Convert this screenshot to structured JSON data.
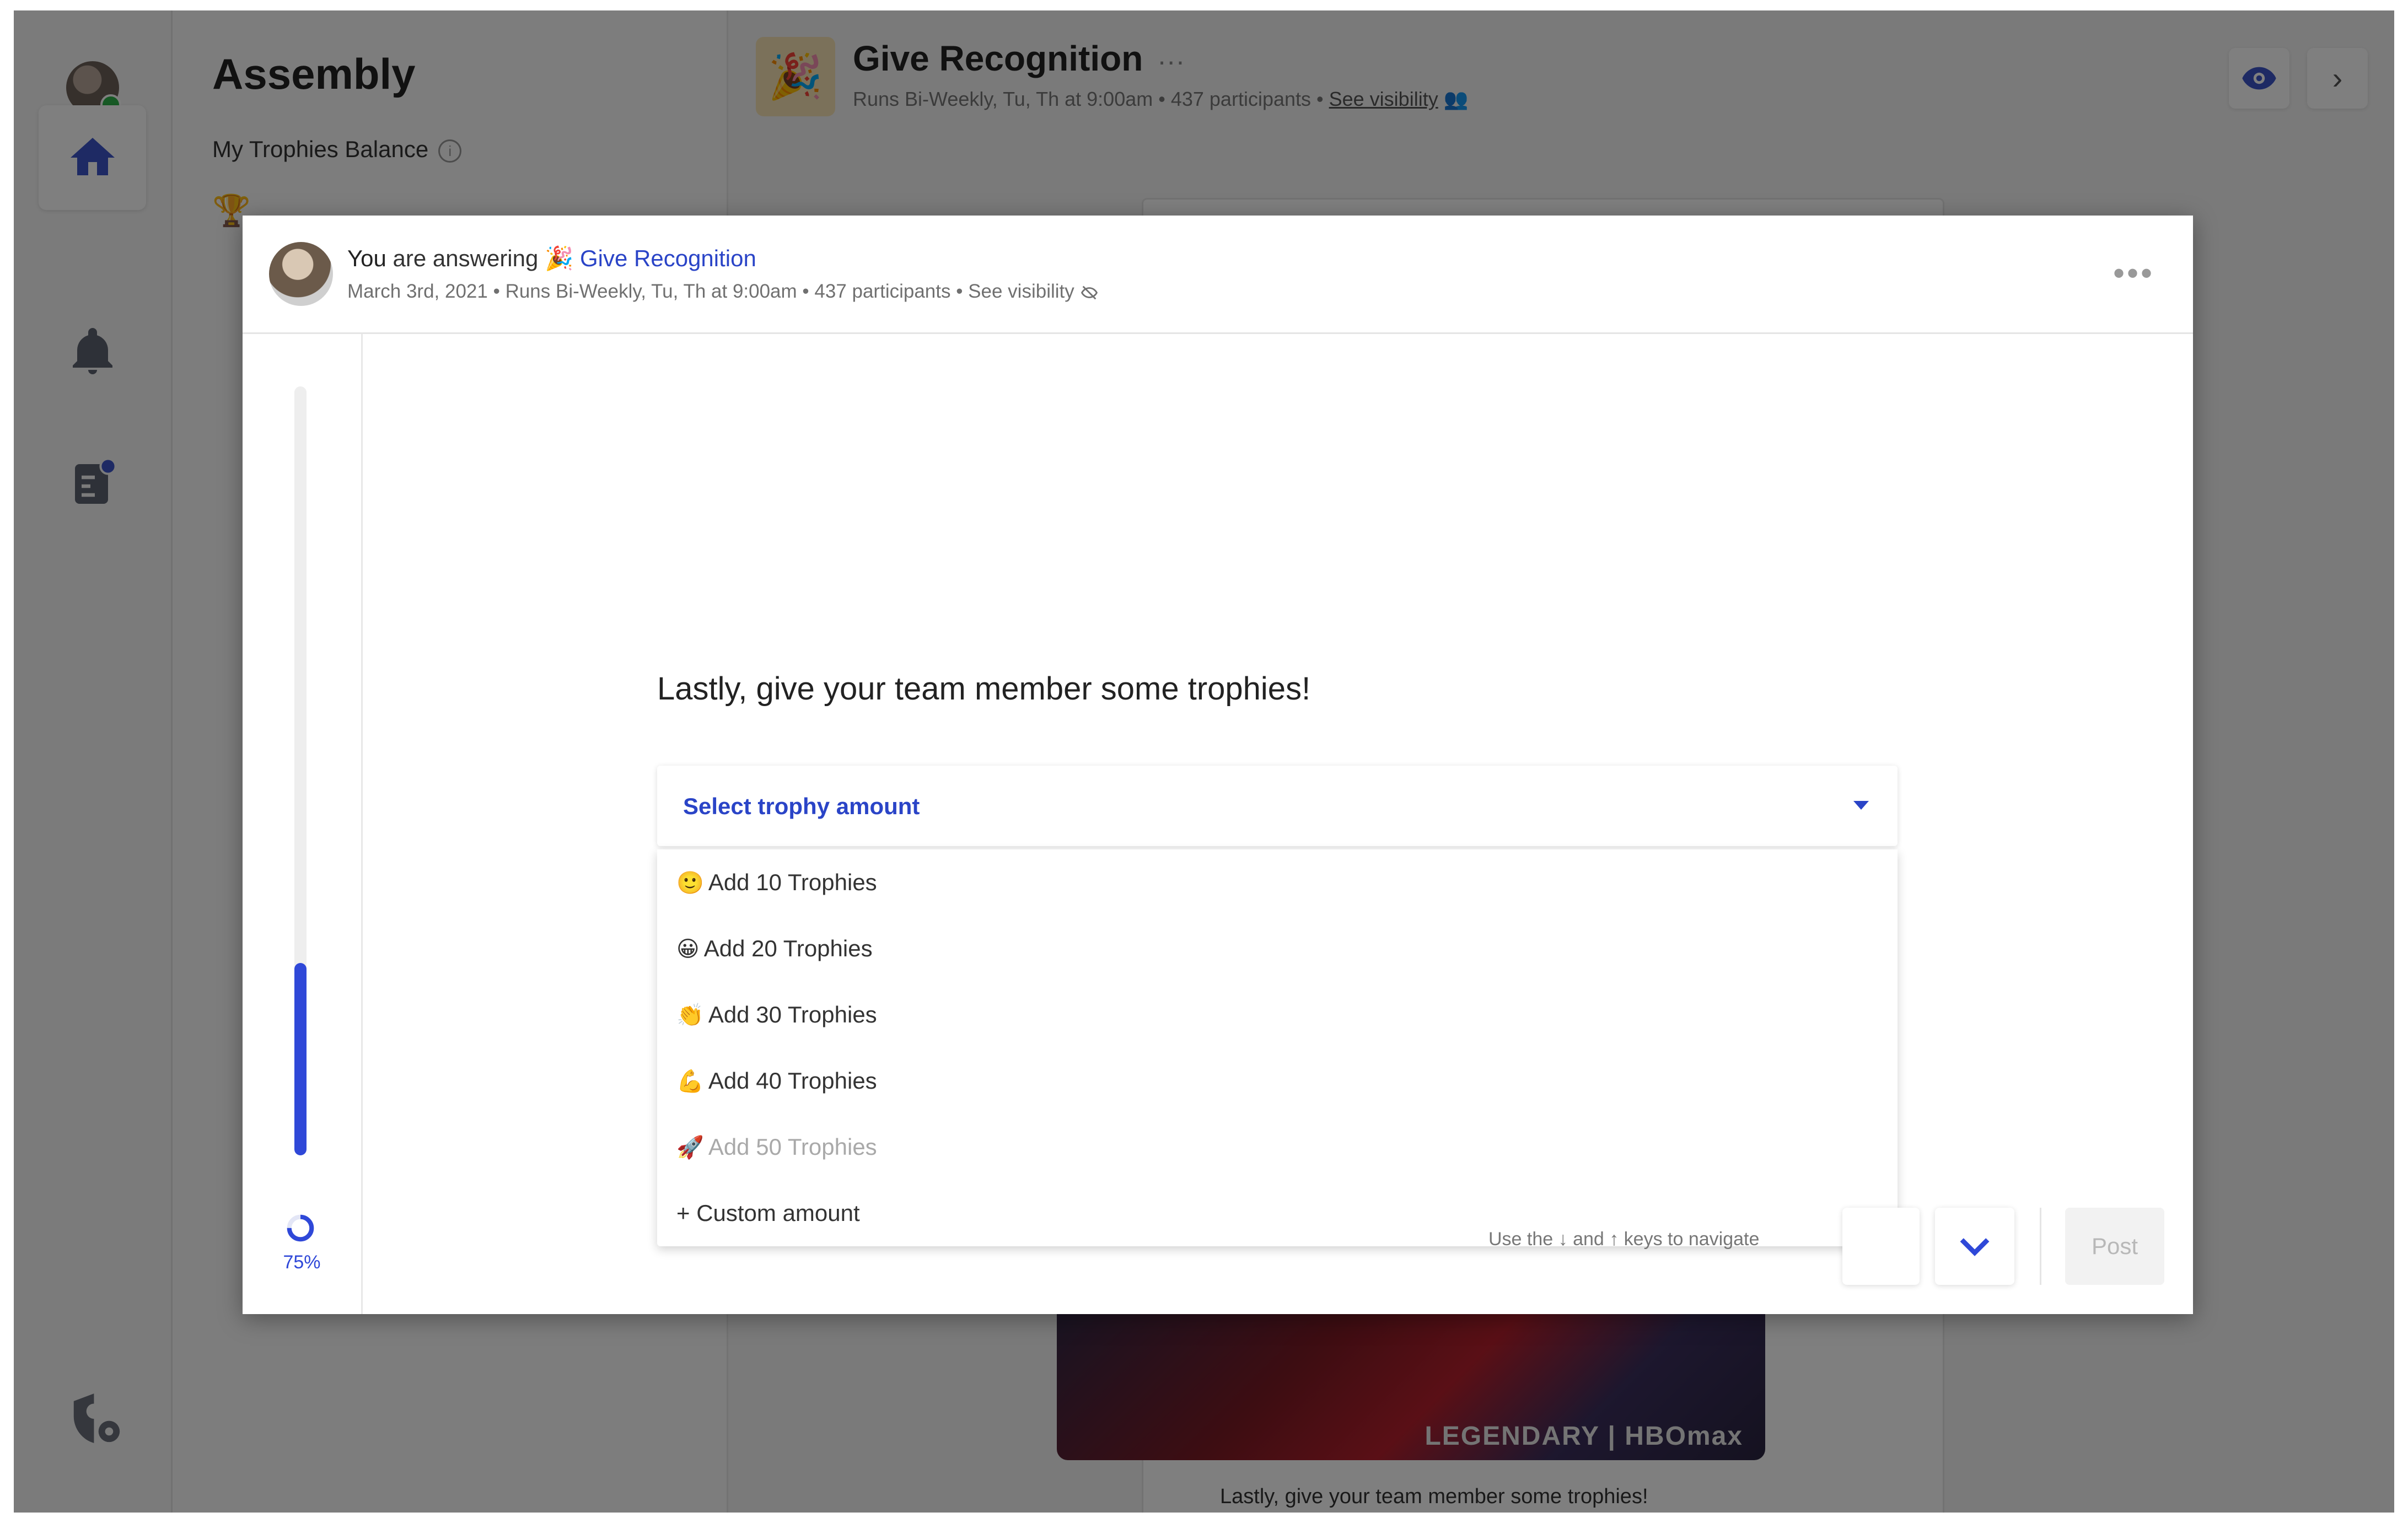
{
  "app": {
    "brand": "Assembly",
    "balance_label": "My Trophies Balance",
    "trophy_icon": "trophy-icon"
  },
  "feed": {
    "title": "Give Recognition",
    "more": "···",
    "meta": "Runs Bi-Weekly, Tu, Th at 9:00am • 437 participants • ",
    "see_visibility": "See visibility",
    "caption": "Lastly, give your team member some trophies!",
    "gif_brand": "LEGENDARY | HBOmax"
  },
  "modal": {
    "answering_you": "You",
    "answering_text": " are answering ",
    "flow_emoji": "🎉",
    "flow_name": "Give Recognition",
    "meta": "March 3rd, 2021 • Runs Bi-Weekly, Tu, Th at 9:00am • 437 participants • See visibility",
    "more": "•••",
    "progress_percent": 75,
    "progress_label": "75%",
    "question": "Lastly, give your team member some trophies!",
    "select_label": "Select trophy amount",
    "options": [
      {
        "emoji": "🙂",
        "label": "Add 10 Trophies",
        "disabled": false
      },
      {
        "emoji": "😀",
        "label": "Add 20 Trophies",
        "disabled": false
      },
      {
        "emoji": "👏",
        "label": "Add 30 Trophies",
        "disabled": false
      },
      {
        "emoji": "💪",
        "label": "Add 40 Trophies",
        "disabled": false
      },
      {
        "emoji": "🚀",
        "label": "Add 50 Trophies",
        "disabled": true
      },
      {
        "emoji": "",
        "label": "+ Custom amount",
        "disabled": false
      }
    ],
    "nav_hint": "Use the ↓ and ↑ keys to navigate",
    "post_label": "Post"
  },
  "colors": {
    "accent": "#2f48d8",
    "link": "#2a44c7",
    "online": "#2fb34a"
  }
}
